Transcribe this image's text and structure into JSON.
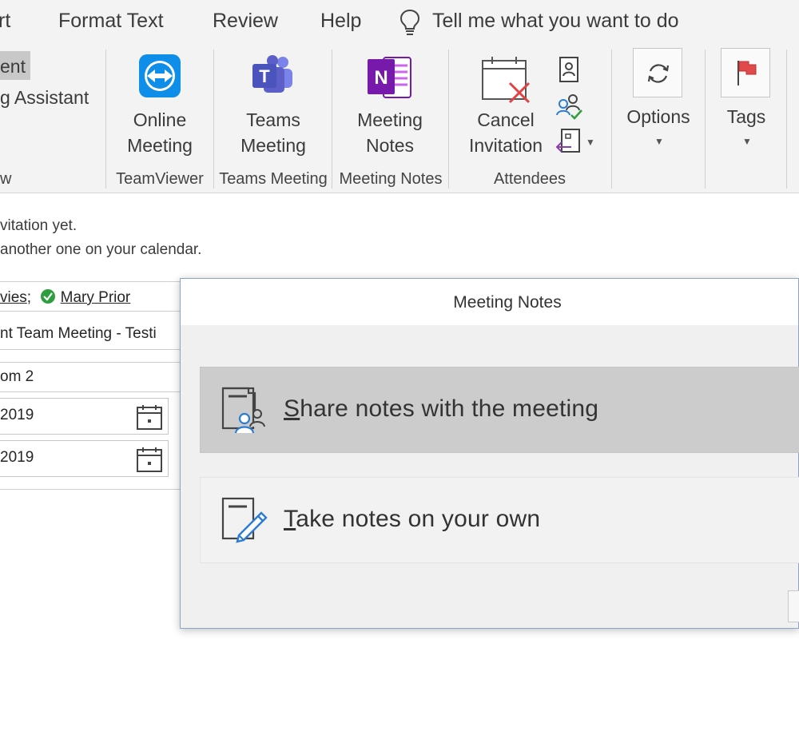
{
  "ribbon_tabs": {
    "insert_partial": "rt",
    "format_text": "Format Text",
    "review": "Review",
    "help": "Help",
    "tell_me": "Tell me what you want to do"
  },
  "ribbon": {
    "left_partial": {
      "current_partial": "ent",
      "assistant_partial": "g Assistant",
      "group_partial": "w"
    },
    "online_meeting": {
      "line1": "Online",
      "line2": "Meeting",
      "group": "TeamViewer"
    },
    "teams_meeting": {
      "line1": "Teams",
      "line2": "Meeting",
      "group": "Teams Meeting"
    },
    "meeting_notes": {
      "line1": "Meeting",
      "line2": "Notes",
      "group": "Meeting Notes"
    },
    "cancel_invitation": {
      "line1": "Cancel",
      "line2": "Invitation",
      "group": "Attendees"
    },
    "options": {
      "label": "Options"
    },
    "tags": {
      "label": "Tags"
    }
  },
  "appointment": {
    "info_line1": "vitation yet.",
    "info_line2": "another one on your calendar.",
    "attendee_partial": "vies",
    "attendee_sep": ";",
    "attendee2": "Mary Prior",
    "subject_partial": "nt Team Meeting - Testi",
    "location_partial": "om 2",
    "start_date_partial": "2019",
    "end_date_partial": "2019"
  },
  "dialog": {
    "title": "Meeting Notes",
    "options": [
      {
        "mnemonic": "S",
        "rest": "hare notes with the meeting"
      },
      {
        "mnemonic": "T",
        "rest": "ake notes on your own"
      }
    ]
  },
  "colors": {
    "teamviewer_blue": "#0e8ee9",
    "teams_purple": "#5b5fc7",
    "onenote_purple": "#7719aa",
    "cancel_red": "#e04343",
    "flag_red": "#e04a4a",
    "accepted_green": "#2e9e3e",
    "selected_option_bg": "#cccccc"
  }
}
